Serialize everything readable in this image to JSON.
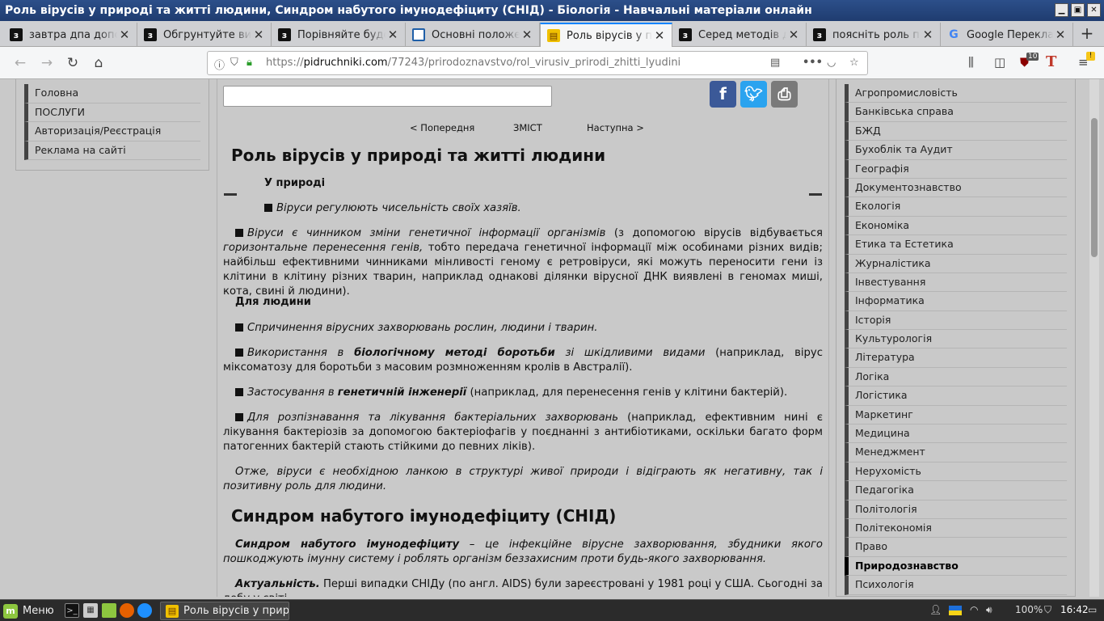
{
  "window": {
    "title": "Роль вірусів у природі та житті людини, Синдром набутого імунодефіциту (СНІД) - Біологія - Навчальні матеріали онлайн - Mozilla Firefox"
  },
  "tabs": [
    {
      "label": "завтра дпа допомогі",
      "icon": "z-icon"
    },
    {
      "label": "Обгрунтуйте визн",
      "icon": "z-icon"
    },
    {
      "label": "Порівняйте будов",
      "icon": "z-icon"
    },
    {
      "label": "Основні положення",
      "icon": "doc-icon"
    },
    {
      "label": "Роль вірусів у прир",
      "icon": "book-icon",
      "active": true
    },
    {
      "label": "Серед методів док",
      "icon": "z-icon"
    },
    {
      "label": "поясніть роль прир",
      "icon": "z-icon"
    },
    {
      "label": "Google Перекладач",
      "icon": "google-icon"
    }
  ],
  "url": {
    "scheme": "https://",
    "host": "pidruchniki.com",
    "path": "/77243/prirodoznavstvo/rol_virusiv_prirodi_zhitti_lyudini"
  },
  "toolbar": {
    "ublock_count": "10"
  },
  "left_menu": [
    "Головна",
    "ПОСЛУГИ",
    "Авторизація/Реєстрація",
    "Реклама на сайті"
  ],
  "pagenav": {
    "prev": "< Попередня",
    "toc": "ЗМІСТ",
    "next": "Наступна >"
  },
  "article": {
    "h1": "Роль вірусів у природі та житті людини",
    "nature_head": "У природі",
    "p1": "Віруси регулюють чисельність своїх хазяїв.",
    "p2_i": "Віруси є чинником зміни генетичної інформації організмів",
    "p2_a": " (з допомогою вірусів відбувається ",
    "p2_i2": "горизонтальне перенесення генів,",
    "p2_b": " тобто передача генетичної інформації між особинами різних видів; найбільш ефективними чинниками мінливості геному є ретровіруси, які можуть переносити гени із клітини в клітину різних тварин, наприклад однакові ділянки вірусної ДНК виявлені в геномах миші, кота, свині й людини).",
    "human_head": "Для людини",
    "p3": "Спричинення вірусних захворювань рослин, людини і тварин.",
    "p4_i": "Використання в ",
    "p4_bi": "біологічному методі боротьби",
    "p4_i2": " зі шкідливими видами",
    "p4_r": " (наприклад, вірус міксоматозу для боротьби з масовим розмноженням кролів в Австралії).",
    "p5_i": "Застосування в ",
    "p5_bi": "генетичній інженерії",
    "p5_r": " (наприклад, для перенесення генів у клітини бактерій).",
    "p6_i": "Для розпізнавання та лікування бактеріальних захворювань",
    "p6_r": " (наприклад, ефективним нині є лікування бактеріозів за допомогою бактеріофагів у поєднанні з антибіотиками, оскільки багато форм патогенних бактерій стають стійкими до певних ліків).",
    "p7": "Отже, віруси є необхідною ланкою в структурі живої природи і відіграють як негативну, так і позитивну роль для людини.",
    "h2": "Синдром набутого імунодефіциту (СНІД)",
    "p8_bi": "Синдром набутого імунодефіциту",
    "p8_i": " – це інфекційне вірусне захворювання, збудники якого пошкоджують імунну систему і роблять організм беззахисним проти будь-якого захворювання.",
    "p9_bi": "Актуальність.",
    "p9_r": " Перші випадки СНІДу (по англ. AIDS) були зареєстровані у 1981 році у США. Сьогодні за добу у світі"
  },
  "right_menu": [
    "Агропромисловість",
    "Банківська справа",
    "БЖД",
    "Бухоблік та Аудит",
    "Географія",
    "Документознавство",
    "Екологія",
    "Економіка",
    "Етика та Естетика",
    "Журналістика",
    "Інвестування",
    "Інформатика",
    "Історія",
    "Культурологія",
    "Література",
    "Логіка",
    "Логістика",
    "Маркетинг",
    "Медицина",
    "Менеджмент",
    "Нерухомість",
    "Педагогіка",
    "Політологія",
    "Політекономія",
    "Право",
    "Природознавство",
    "Психологія"
  ],
  "right_menu_active": "Природознавство",
  "taskbar": {
    "menu_label": "Меню",
    "task_label": "Роль вірусів у приро...",
    "volume": "100%",
    "clock": "16:42"
  }
}
